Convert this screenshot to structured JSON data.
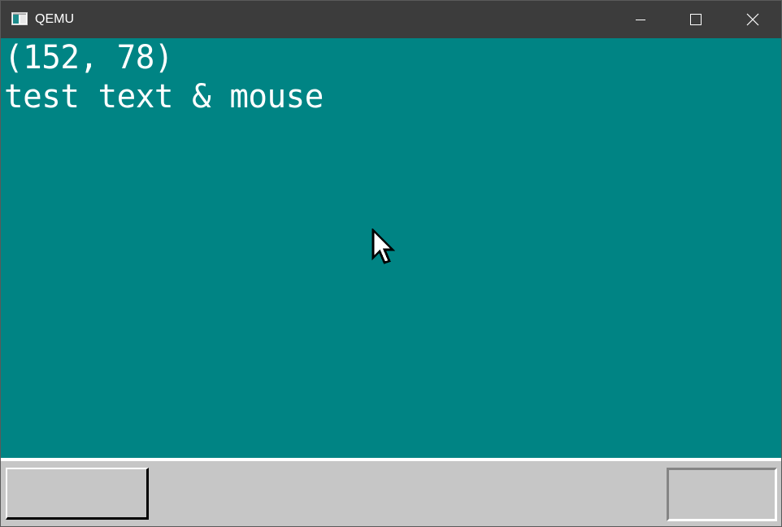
{
  "window": {
    "title": "QEMU",
    "icon": "qemu-app-icon",
    "controls": [
      "minimize-icon",
      "maximize-icon",
      "close-icon"
    ]
  },
  "screen": {
    "background_color": "#008484",
    "text_color": "#ffffff",
    "lines": {
      "coords": "(152, 78)",
      "message": "test text & mouse"
    },
    "cursor": "arrow-cursor-icon"
  },
  "taskbar": {
    "background_color": "#c6c6c6",
    "start_button_label": "",
    "tray_label": ""
  }
}
